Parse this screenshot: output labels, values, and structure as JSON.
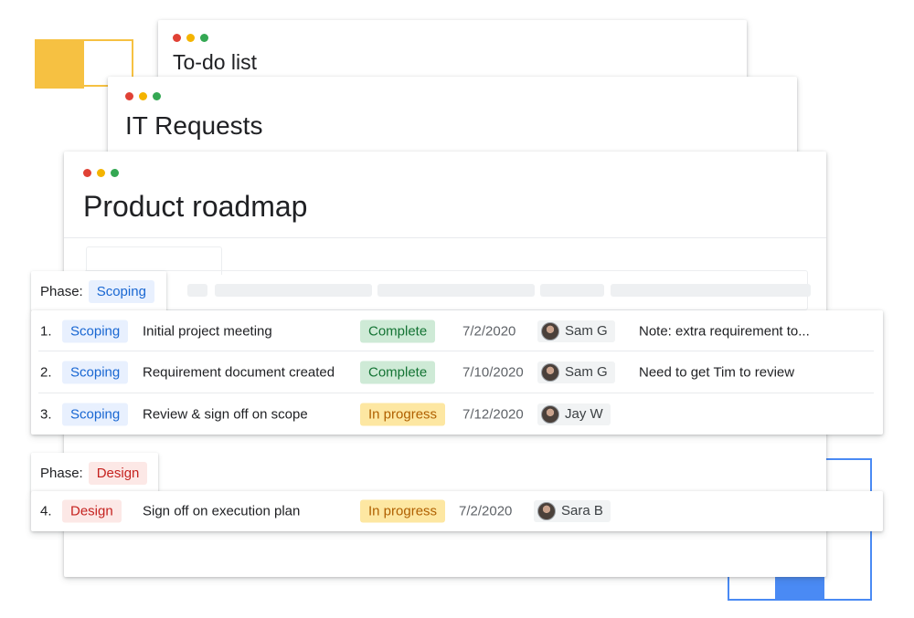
{
  "windows": {
    "todo": {
      "title": "To-do list"
    },
    "it_requests": {
      "title": "IT Requests"
    },
    "roadmap": {
      "title": "Product roadmap"
    }
  },
  "colors": {
    "dot_red": "#e04135",
    "dot_yellow": "#f4b400",
    "dot_green": "#34a853",
    "accent_yellow": "#f6c142",
    "accent_blue": "#4a8af4"
  },
  "groups": [
    {
      "phase_label": "Phase:",
      "phase": "Scoping",
      "rows": [
        {
          "num": "1.",
          "phase": "Scoping",
          "task": "Initial project meeting",
          "status": "Complete",
          "date": "7/2/2020",
          "assignee": "Sam G",
          "note": "Note: extra requirement to..."
        },
        {
          "num": "2.",
          "phase": "Scoping",
          "task": "Requirement document created",
          "status": "Complete",
          "date": "7/10/2020",
          "assignee": "Sam G",
          "note": "Need to get Tim to review"
        },
        {
          "num": "3.",
          "phase": "Scoping",
          "task": "Review & sign off on scope",
          "status": "In progress",
          "date": "7/12/2020",
          "assignee": "Jay W",
          "note": ""
        }
      ]
    },
    {
      "phase_label": "Phase:",
      "phase": "Design",
      "rows": [
        {
          "num": "4.",
          "phase": "Design",
          "task": "Sign off on execution plan",
          "status": "In progress",
          "date": "7/2/2020",
          "assignee": "Sara B",
          "note": ""
        }
      ]
    }
  ],
  "icons": {
    "avatar": "person-avatar-icon",
    "window_controls": "traffic-light-dots"
  }
}
